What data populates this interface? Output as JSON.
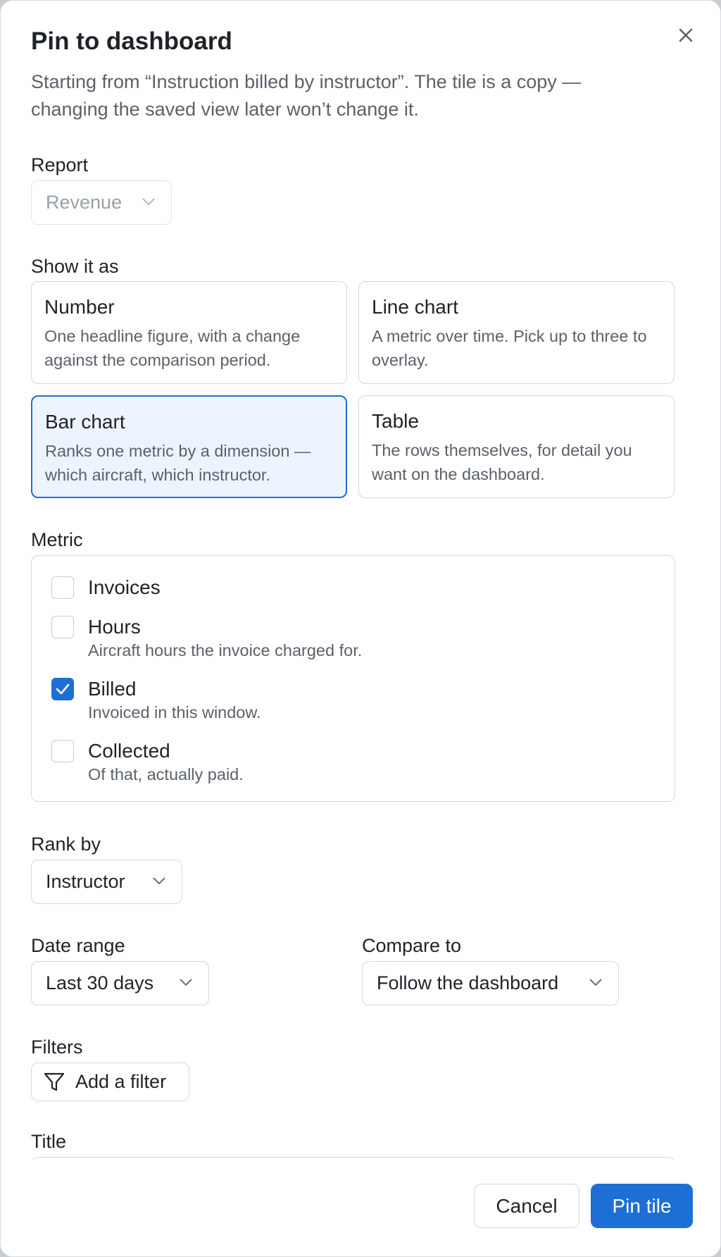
{
  "dialog": {
    "title": "Pin to dashboard",
    "subtitle": "Starting from “Instruction billed by instructor”. The tile is a copy — changing the saved view later won’t change it."
  },
  "report": {
    "label": "Report",
    "value": "Revenue"
  },
  "show_as": {
    "label": "Show it as",
    "options": [
      {
        "title": "Number",
        "desc": "One headline figure, with a change against the comparison period."
      },
      {
        "title": "Line chart",
        "desc": "A metric over time. Pick up to three to overlay."
      },
      {
        "title": "Bar chart",
        "desc": "Ranks one metric by a dimension — which aircraft, which instructor."
      },
      {
        "title": "Table",
        "desc": "The rows themselves, for detail you want on the dashboard."
      }
    ],
    "selected": "Bar chart"
  },
  "metric": {
    "label": "Metric",
    "items": [
      {
        "title": "Invoices",
        "desc": "",
        "checked": false
      },
      {
        "title": "Hours",
        "desc": "Aircraft hours the invoice charged for.",
        "checked": false
      },
      {
        "title": "Billed",
        "desc": "Invoiced in this window.",
        "checked": true
      },
      {
        "title": "Collected",
        "desc": "Of that, actually paid.",
        "checked": false
      }
    ]
  },
  "rank_by": {
    "label": "Rank by",
    "value": "Instructor"
  },
  "date_range": {
    "label": "Date range",
    "value": "Last 30 days"
  },
  "compare_to": {
    "label": "Compare to",
    "value": "Follow the dashboard"
  },
  "filters": {
    "label": "Filters",
    "add_label": "Add a filter"
  },
  "title_field": {
    "label": "Title"
  },
  "actions": {
    "cancel": "Cancel",
    "pin": "Pin tile"
  },
  "colors": {
    "accent": "#1d6fd6",
    "selected_bg": "#eef4fd",
    "border": "#d4d7dc",
    "muted_text": "#5b616b"
  }
}
